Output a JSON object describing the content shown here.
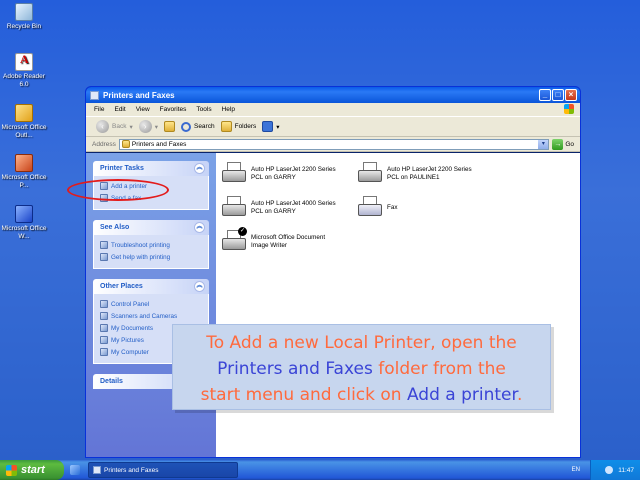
{
  "desktop": {
    "icons": [
      {
        "label": "Recycle Bin"
      },
      {
        "label": "Adobe Reader 6.0"
      },
      {
        "label": "Microsoft Office Outl..."
      },
      {
        "label": "Microsoft Office P..."
      },
      {
        "label": "Microsoft Office W..."
      }
    ]
  },
  "window": {
    "title": "Printers and Faxes",
    "menu": [
      "File",
      "Edit",
      "View",
      "Favorites",
      "Tools",
      "Help"
    ],
    "toolbar": {
      "back": "Back",
      "search": "Search",
      "folders": "Folders"
    },
    "address": {
      "label": "Address",
      "value": "Printers and Faxes",
      "go": "Go"
    },
    "panels": [
      {
        "title": "Printer Tasks",
        "links": [
          "Add a printer",
          "Send a fax"
        ]
      },
      {
        "title": "See Also",
        "links": [
          "Troubleshoot printing",
          "Get help with printing"
        ]
      },
      {
        "title": "Other Places",
        "links": [
          "Control Panel",
          "Scanners and Cameras",
          "My Documents",
          "My Pictures",
          "My Computer"
        ]
      },
      {
        "title": "Details",
        "links": []
      }
    ],
    "printers": [
      {
        "line1": "Auto HP LaserJet 2200 Series",
        "line2": "PCL on GARRY"
      },
      {
        "line1": "Auto HP LaserJet 2200 Series",
        "line2": "PCL on PAULINE1"
      },
      {
        "line1": "Auto HP LaserJet 4000 Series",
        "line2": "PCL on GARRY"
      },
      {
        "line1": "Fax",
        "line2": ""
      },
      {
        "line1": "Microsoft Office Document",
        "line2": "Image Writer"
      }
    ]
  },
  "caption": {
    "part1": "To Add a new Local Printer, open the",
    "part2": "Printers and Faxes",
    "part3": " folder from the",
    "part4": "start menu and click on ",
    "part5": "Add a printer",
    "part6": "."
  },
  "taskbar": {
    "start": "start",
    "task": "Printers and Faxes",
    "lang": "EN",
    "time": "11:47"
  }
}
